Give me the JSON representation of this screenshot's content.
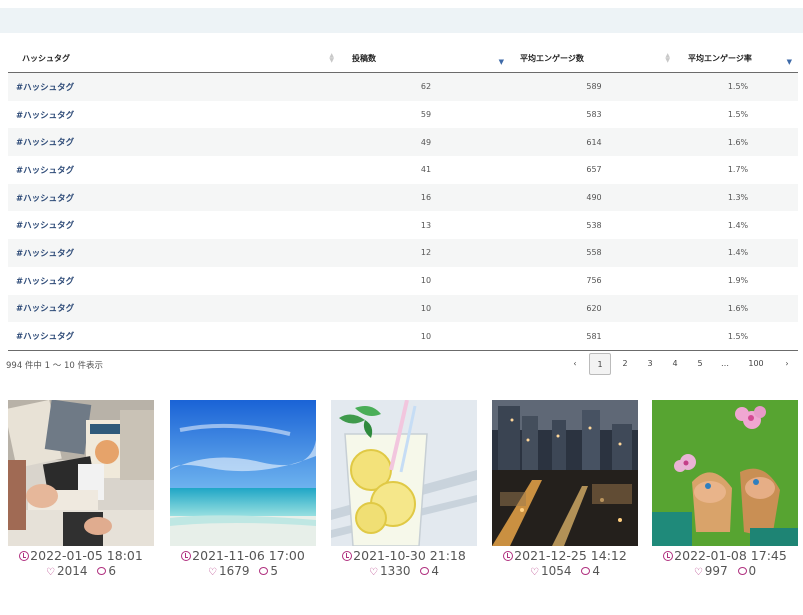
{
  "table": {
    "headers": [
      "ハッシュタグ",
      "投稿数",
      "平均エンゲージ数",
      "平均エンゲージ率"
    ],
    "rows": [
      {
        "tag": "#ハッシュタグ",
        "posts": "62",
        "avg_eng": "589",
        "rate": "1.5%"
      },
      {
        "tag": "#ハッシュタグ",
        "posts": "59",
        "avg_eng": "583",
        "rate": "1.5%"
      },
      {
        "tag": "#ハッシュタグ",
        "posts": "49",
        "avg_eng": "614",
        "rate": "1.6%"
      },
      {
        "tag": "#ハッシュタグ",
        "posts": "41",
        "avg_eng": "657",
        "rate": "1.7%"
      },
      {
        "tag": "#ハッシュタグ",
        "posts": "16",
        "avg_eng": "490",
        "rate": "1.3%"
      },
      {
        "tag": "#ハッシュタグ",
        "posts": "13",
        "avg_eng": "538",
        "rate": "1.4%"
      },
      {
        "tag": "#ハッシュタグ",
        "posts": "12",
        "avg_eng": "558",
        "rate": "1.4%"
      },
      {
        "tag": "#ハッシュタグ",
        "posts": "10",
        "avg_eng": "756",
        "rate": "1.9%"
      },
      {
        "tag": "#ハッシュタグ",
        "posts": "10",
        "avg_eng": "620",
        "rate": "1.6%"
      },
      {
        "tag": "#ハッシュタグ",
        "posts": "10",
        "avg_eng": "581",
        "rate": "1.5%"
      }
    ]
  },
  "pagination": {
    "summary": "994 件中 1 ～ 10 件表示",
    "prev": "‹",
    "pages": [
      "1",
      "2",
      "3",
      "4",
      "5",
      "…",
      "100"
    ],
    "next": "›",
    "current": "1"
  },
  "posts": [
    {
      "date": "2022-01-05 18:01",
      "likes": "2014",
      "comments": "6"
    },
    {
      "date": "2021-11-06 17:00",
      "likes": "1679",
      "comments": "5"
    },
    {
      "date": "2021-10-30 21:18",
      "likes": "1330",
      "comments": "4"
    },
    {
      "date": "2021-12-25 14:12",
      "likes": "1054",
      "comments": "4"
    },
    {
      "date": "2022-01-08 17:45",
      "likes": "997",
      "comments": "0"
    }
  ],
  "colors": {
    "accent": "#b0307f",
    "tag_text": "#2e4b78",
    "sort_active": "#3e6aa8",
    "band": "#edf3f6"
  }
}
